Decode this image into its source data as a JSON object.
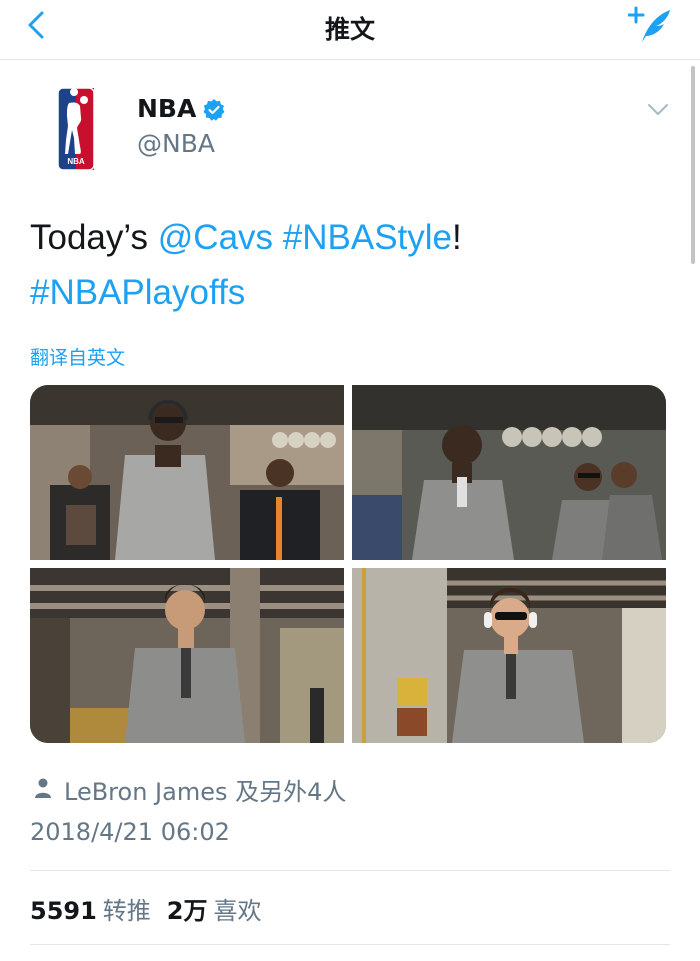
{
  "nav": {
    "title": "推文",
    "back_icon": "chevron-left-icon",
    "compose_icon": "compose-tweet-icon"
  },
  "account": {
    "name": "NBA",
    "handle": "@NBA",
    "verified": true,
    "logo_icon": "nba-logo"
  },
  "tweet": {
    "text_1": "Today’s ",
    "mention": "@Cavs",
    "space": " ",
    "hashtag_1": "#NBAStyle",
    "text_2": "!",
    "hashtag_2": "#NBAPlayoffs"
  },
  "translate_label": "翻译自英文",
  "media": {
    "photos": [
      {
        "description_icon": "photo-player-headphones-sunglasses"
      },
      {
        "description_icon": "photo-player-grey-suit"
      },
      {
        "description_icon": "photo-player-walking"
      },
      {
        "description_icon": "photo-player-sunglasses-headphones"
      }
    ]
  },
  "tagged": {
    "text": "LeBron James 及另外4人",
    "icon": "person-icon"
  },
  "timestamp": "2018/4/21 06:02",
  "stats": {
    "retweets_count": "5591",
    "retweets_label": "转推",
    "likes_count": "2万",
    "likes_label": "喜欢"
  },
  "colors": {
    "accent": "#1da1f2",
    "secondary_text": "#657786",
    "divider": "#e1e8ed"
  }
}
